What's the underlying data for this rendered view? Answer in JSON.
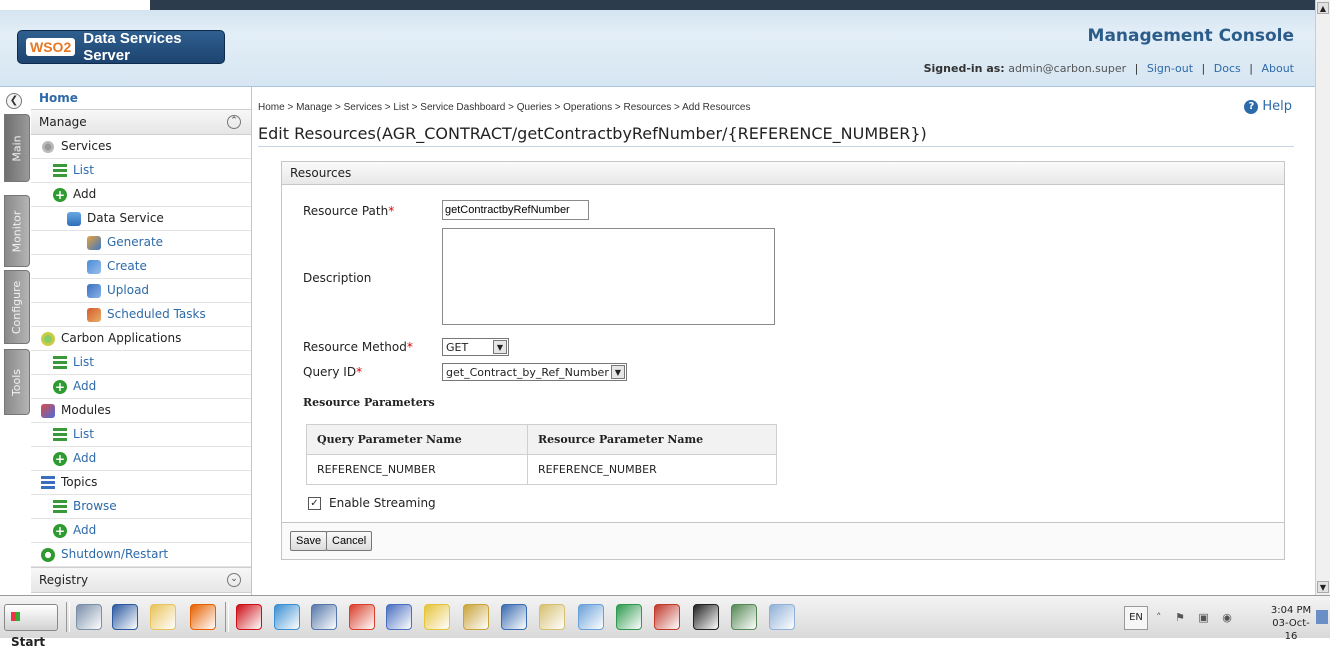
{
  "header": {
    "logo_wso2": "WSO2",
    "product_name": "Data Services Server",
    "console_title": "Management Console",
    "signed_in_label": "Signed-in as:",
    "signed_in_user": "admin@carbon.super",
    "sign_out": "Sign-out",
    "docs": "Docs",
    "about": "About"
  },
  "vtabs": [
    {
      "label": "Main",
      "active": true
    },
    {
      "label": "Monitor",
      "active": false
    },
    {
      "label": "Configure",
      "active": false
    },
    {
      "label": "Tools",
      "active": false
    }
  ],
  "menu": {
    "home": "Home",
    "manage": "Manage",
    "services": "Services",
    "list": "List",
    "add": "Add",
    "data_service": "Data Service",
    "generate": "Generate",
    "create": "Create",
    "upload": "Upload",
    "scheduled_tasks": "Scheduled Tasks",
    "carbon_applications": "Carbon Applications",
    "ca_list": "List",
    "ca_add": "Add",
    "modules": "Modules",
    "mod_list": "List",
    "mod_add": "Add",
    "topics": "Topics",
    "browse": "Browse",
    "topics_add": "Add",
    "shutdown": "Shutdown/Restart",
    "registry": "Registry"
  },
  "breadcrumb": "Home > Manage > Services > List > Service Dashboard > Queries > Operations > Resources > Add Resources",
  "help": "Help",
  "page_title": "Edit Resources(AGR_CONTRACT/getContractbyRefNumber/{REFERENCE_NUMBER})",
  "form": {
    "section_title": "Resources",
    "resource_path_label": "Resource Path",
    "resource_path_value": "getContractbyRefNumber",
    "description_label": "Description",
    "description_value": "",
    "resource_method_label": "Resource Method",
    "resource_method_value": "GET",
    "query_id_label": "Query ID",
    "query_id_value": "get_Contract_by_Ref_Number",
    "required_mark": "*",
    "resource_parameters_title": "Resource Parameters",
    "param_table": {
      "headers": [
        "Query Parameter Name",
        "Resource Parameter Name"
      ],
      "rows": [
        [
          "REFERENCE_NUMBER",
          "REFERENCE_NUMBER"
        ]
      ]
    },
    "enable_streaming_label": "Enable Streaming",
    "enable_streaming_checked": true,
    "save_label": "Save",
    "cancel_label": "Cancel"
  },
  "taskbar": {
    "start": "Start",
    "lang": "EN",
    "time": "3:04 PM",
    "date": "03-Oct-16",
    "apps": [
      {
        "name": "network-tool-icon",
        "color": "#7a8fa8"
      },
      {
        "name": "powershell-icon",
        "color": "#2c5aa0"
      },
      {
        "name": "file-explorer-icon",
        "color": "#e8c35a"
      },
      {
        "name": "firefox-icon",
        "color": "#e66000"
      },
      {
        "name": "opera-icon",
        "color": "#cc0f16"
      },
      {
        "name": "dss-app-icon",
        "color": "#3b8fd3"
      },
      {
        "name": "window-app-icon",
        "color": "#5577aa"
      },
      {
        "name": "chrome-like-icon",
        "color": "#d93f2b"
      },
      {
        "name": "utility-icon",
        "color": "#4a6fc0"
      },
      {
        "name": "radiation-icon",
        "color": "#e5c33a"
      },
      {
        "name": "search-tool-icon",
        "color": "#c9a43a"
      },
      {
        "name": "sql-icon",
        "color": "#3a6bb0"
      },
      {
        "name": "edit-tool-icon",
        "color": "#d6c070"
      },
      {
        "name": "calculator-icon",
        "color": "#6aa0d8"
      },
      {
        "name": "run-app-icon",
        "color": "#2f9a4f"
      },
      {
        "name": "visual-tool-icon",
        "color": "#c0392b"
      },
      {
        "name": "cmd-icon",
        "color": "#222222"
      },
      {
        "name": "monitor-icon",
        "color": "#558855"
      },
      {
        "name": "notepad-icon",
        "color": "#8fb0d8"
      }
    ]
  }
}
